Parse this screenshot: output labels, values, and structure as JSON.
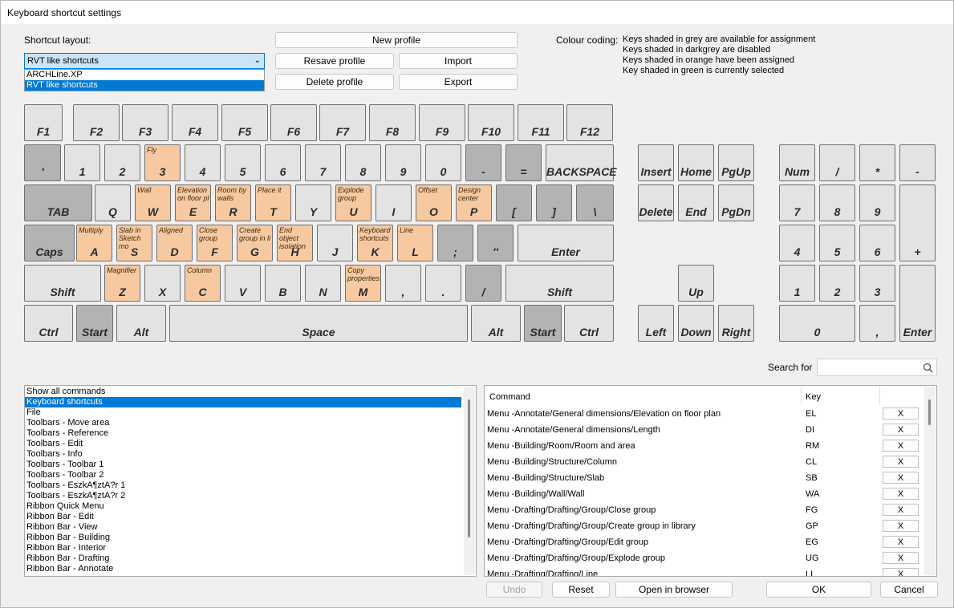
{
  "window": {
    "title": "Keyboard shortcut settings"
  },
  "shortcut_layout": {
    "label": "Shortcut layout:",
    "selected": "RVT like shortcuts",
    "options": [
      "ARCHLine.XP",
      "RVT like shortcuts"
    ]
  },
  "buttons": {
    "new_profile": "New profile",
    "resave_profile": "Resave profile",
    "import": "Import",
    "delete_profile": "Delete profile",
    "export": "Export",
    "undo": "Undo",
    "reset": "Reset",
    "open_in_browser": "Open in browser",
    "ok": "OK",
    "cancel": "Cancel"
  },
  "colour_coding": {
    "label": "Colour coding:",
    "lines": [
      "Keys shaded in grey are available for assignment",
      "Keys shaded in darkgrey are disabled",
      "Keys shaded in orange have been assigned",
      "Key shaded in green is currently selected"
    ]
  },
  "colors": {
    "available": "#e3e3e3",
    "disabled": "#b3b3b3",
    "assigned": "#f6c9a1",
    "selection": "#0078d4"
  },
  "keys": [
    {
      "label": "F1",
      "state": "available",
      "assign": ""
    },
    {
      "label": "F2",
      "state": "available",
      "assign": ""
    },
    {
      "label": "F3",
      "state": "available",
      "assign": ""
    },
    {
      "label": "F4",
      "state": "available",
      "assign": ""
    },
    {
      "label": "F5",
      "state": "available",
      "assign": ""
    },
    {
      "label": "F6",
      "state": "available",
      "assign": ""
    },
    {
      "label": "F7",
      "state": "available",
      "assign": ""
    },
    {
      "label": "F8",
      "state": "available",
      "assign": ""
    },
    {
      "label": "F9",
      "state": "available",
      "assign": ""
    },
    {
      "label": "F10",
      "state": "available",
      "assign": ""
    },
    {
      "label": "F11",
      "state": "available",
      "assign": ""
    },
    {
      "label": "F12",
      "state": "available",
      "assign": ""
    },
    {
      "label": "'",
      "state": "disabled",
      "assign": ""
    },
    {
      "label": "1",
      "state": "available",
      "assign": ""
    },
    {
      "label": "2",
      "state": "available",
      "assign": ""
    },
    {
      "label": "3",
      "state": "assigned",
      "assign": "Fly"
    },
    {
      "label": "4",
      "state": "available",
      "assign": ""
    },
    {
      "label": "5",
      "state": "available",
      "assign": ""
    },
    {
      "label": "6",
      "state": "available",
      "assign": ""
    },
    {
      "label": "7",
      "state": "available",
      "assign": ""
    },
    {
      "label": "8",
      "state": "available",
      "assign": ""
    },
    {
      "label": "9",
      "state": "available",
      "assign": ""
    },
    {
      "label": "0",
      "state": "available",
      "assign": ""
    },
    {
      "label": "-",
      "state": "disabled",
      "assign": ""
    },
    {
      "label": "=",
      "state": "disabled",
      "assign": ""
    },
    {
      "label": "BACKSPACE",
      "state": "available",
      "assign": ""
    },
    {
      "label": "TAB",
      "state": "disabled",
      "assign": ""
    },
    {
      "label": "Q",
      "state": "available",
      "assign": ""
    },
    {
      "label": "W",
      "state": "assigned",
      "assign": "Wall"
    },
    {
      "label": "E",
      "state": "assigned",
      "assign": "Elevation on floor pl"
    },
    {
      "label": "R",
      "state": "assigned",
      "assign": "Room by walls"
    },
    {
      "label": "T",
      "state": "assigned",
      "assign": "Place it"
    },
    {
      "label": "Y",
      "state": "available",
      "assign": ""
    },
    {
      "label": "U",
      "state": "assigned",
      "assign": "Explode group"
    },
    {
      "label": "I",
      "state": "available",
      "assign": ""
    },
    {
      "label": "O",
      "state": "assigned",
      "assign": "Offset"
    },
    {
      "label": "P",
      "state": "assigned",
      "assign": "Design center"
    },
    {
      "label": "[",
      "state": "disabled",
      "assign": ""
    },
    {
      "label": "]",
      "state": "disabled",
      "assign": ""
    },
    {
      "label": "\\",
      "state": "disabled",
      "assign": ""
    },
    {
      "label": "Caps",
      "state": "disabled",
      "assign": ""
    },
    {
      "label": "A",
      "state": "assigned",
      "assign": "Multiply"
    },
    {
      "label": "S",
      "state": "assigned",
      "assign": "Slab in Sketch mo"
    },
    {
      "label": "D",
      "state": "assigned",
      "assign": "Aligned"
    },
    {
      "label": "F",
      "state": "assigned",
      "assign": "Close group"
    },
    {
      "label": "G",
      "state": "assigned",
      "assign": "Create group in li"
    },
    {
      "label": "H",
      "state": "assigned",
      "assign": "End object isolation"
    },
    {
      "label": "J",
      "state": "available",
      "assign": ""
    },
    {
      "label": "K",
      "state": "assigned",
      "assign": "Keyboard shortcuts"
    },
    {
      "label": "L",
      "state": "assigned",
      "assign": "Line"
    },
    {
      "label": ";",
      "state": "disabled",
      "assign": ""
    },
    {
      "label": "''",
      "state": "disabled",
      "assign": ""
    },
    {
      "label": "Enter",
      "state": "available",
      "assign": ""
    },
    {
      "label": "Shift",
      "state": "available",
      "assign": ""
    },
    {
      "label": "Z",
      "state": "assigned",
      "assign": "Magnifier"
    },
    {
      "label": "X",
      "state": "available",
      "assign": ""
    },
    {
      "label": "C",
      "state": "assigned",
      "assign": "Column"
    },
    {
      "label": "V",
      "state": "available",
      "assign": ""
    },
    {
      "label": "B",
      "state": "available",
      "assign": ""
    },
    {
      "label": "N",
      "state": "available",
      "assign": ""
    },
    {
      "label": "M",
      "state": "assigned",
      "assign": "Copy properties"
    },
    {
      "label": ",",
      "state": "available",
      "assign": ""
    },
    {
      "label": ".",
      "state": "available",
      "assign": ""
    },
    {
      "label": "/",
      "state": "disabled",
      "assign": ""
    },
    {
      "label": "Shift",
      "state": "available",
      "assign": ""
    },
    {
      "label": "Ctrl",
      "state": "available",
      "assign": ""
    },
    {
      "label": "Start",
      "state": "disabled",
      "assign": ""
    },
    {
      "label": "Alt",
      "state": "available",
      "assign": ""
    },
    {
      "label": "Space",
      "state": "available",
      "assign": ""
    },
    {
      "label": "Alt",
      "state": "available",
      "assign": ""
    },
    {
      "label": "Start",
      "state": "disabled",
      "assign": ""
    },
    {
      "label": "Ctrl",
      "state": "available",
      "assign": ""
    },
    {
      "label": "Insert",
      "state": "available",
      "assign": ""
    },
    {
      "label": "Home",
      "state": "available",
      "assign": ""
    },
    {
      "label": "PgUp",
      "state": "available",
      "assign": ""
    },
    {
      "label": "Delete",
      "state": "available",
      "assign": ""
    },
    {
      "label": "End",
      "state": "available",
      "assign": ""
    },
    {
      "label": "PgDn",
      "state": "available",
      "assign": ""
    },
    {
      "label": "Up",
      "state": "available",
      "assign": ""
    },
    {
      "label": "Left",
      "state": "available",
      "assign": ""
    },
    {
      "label": "Down",
      "state": "available",
      "assign": ""
    },
    {
      "label": "Right",
      "state": "available",
      "assign": ""
    },
    {
      "label": "Num",
      "state": "available",
      "assign": ""
    },
    {
      "label": "/",
      "state": "available",
      "assign": ""
    },
    {
      "label": "*",
      "state": "available",
      "assign": ""
    },
    {
      "label": "-",
      "state": "available",
      "assign": ""
    },
    {
      "label": "7",
      "state": "available",
      "assign": ""
    },
    {
      "label": "8",
      "state": "available",
      "assign": ""
    },
    {
      "label": "9",
      "state": "available",
      "assign": ""
    },
    {
      "label": "+",
      "state": "available",
      "assign": ""
    },
    {
      "label": "4",
      "state": "available",
      "assign": ""
    },
    {
      "label": "5",
      "state": "available",
      "assign": ""
    },
    {
      "label": "6",
      "state": "available",
      "assign": ""
    },
    {
      "label": "1",
      "state": "available",
      "assign": ""
    },
    {
      "label": "2",
      "state": "available",
      "assign": ""
    },
    {
      "label": "3",
      "state": "available",
      "assign": ""
    },
    {
      "label": "Enter",
      "state": "available",
      "assign": ""
    },
    {
      "label": "0",
      "state": "available",
      "assign": ""
    },
    {
      "label": ",",
      "state": "available",
      "assign": ""
    }
  ],
  "search": {
    "label": "Search for",
    "value": "",
    "icon": "search-icon"
  },
  "categories": {
    "selected_index": 1,
    "items": [
      "Show all commands",
      "Keyboard shortcuts",
      "File",
      "Toolbars - Move area",
      "Toolbars - Reference",
      "Toolbars - Edit",
      "Toolbars - Info",
      "Toolbars - Toolbar 1",
      "Toolbars - Toolbar 2",
      "Toolbars - EszkA¶ztA?r 1",
      "Toolbars - EszkA¶ztA?r 2",
      "Ribbon Quick Menu",
      "Ribbon Bar - Edit",
      "Ribbon Bar - View",
      "Ribbon Bar - Building",
      "Ribbon Bar - Interior",
      "Ribbon Bar - Drafting",
      "Ribbon Bar - Annotate"
    ]
  },
  "commands_table": {
    "headers": {
      "command": "Command",
      "key": "Key"
    },
    "remove_label": "X",
    "rows": [
      {
        "command": "Menu -Annotate/General dimensions/Elevation on floor plan",
        "key": "EL"
      },
      {
        "command": "Menu -Annotate/General dimensions/Length",
        "key": "DI"
      },
      {
        "command": "Menu -Building/Room/Room and area",
        "key": "RM"
      },
      {
        "command": "Menu -Building/Structure/Column",
        "key": "CL"
      },
      {
        "command": "Menu -Building/Structure/Slab",
        "key": "SB"
      },
      {
        "command": "Menu -Building/Wall/Wall",
        "key": "WA"
      },
      {
        "command": "Menu -Drafting/Drafting/Group/Close group",
        "key": "FG"
      },
      {
        "command": "Menu -Drafting/Drafting/Group/Create group in library",
        "key": "GP"
      },
      {
        "command": "Menu -Drafting/Drafting/Group/Edit group",
        "key": "EG"
      },
      {
        "command": "Menu -Drafting/Drafting/Group/Explode group",
        "key": "UG"
      },
      {
        "command": "Menu -Drafting/Drafting/Line",
        "key": "LI"
      }
    ]
  }
}
